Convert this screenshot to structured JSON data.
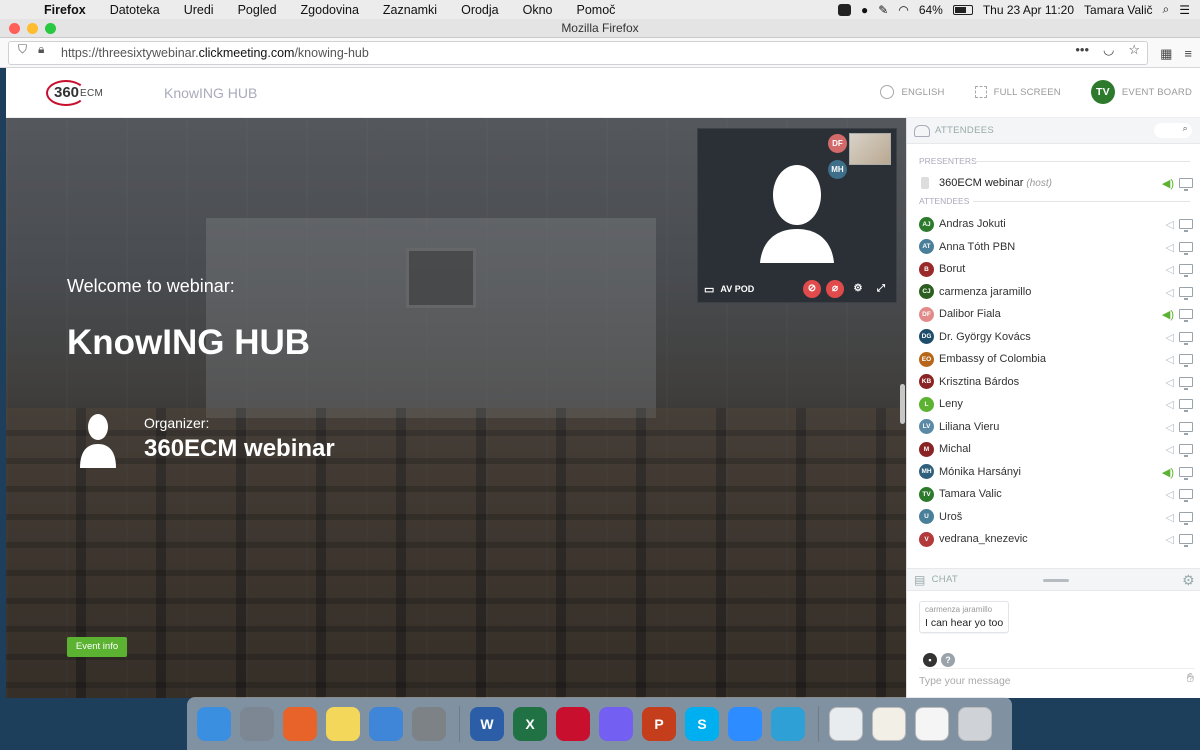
{
  "menubar": {
    "app": "Firefox",
    "items": [
      "Datoteka",
      "Uredi",
      "Pogled",
      "Zgodovina",
      "Zaznamki",
      "Orodja",
      "Okno",
      "Pomoč"
    ],
    "battery": "64%",
    "datetime": "Thu 23 Apr  11:20",
    "user": "Tamara Valič"
  },
  "browser": {
    "window_title": "Mozilla Firefox",
    "url_prefix": "https://threesixtywebinar.",
    "url_domain": "clickmeeting.com",
    "url_path": "/knowing-hub"
  },
  "header": {
    "logo_main": "360",
    "logo_sub": "ECM",
    "hub": "KnowING HUB",
    "language": "ENGLISH",
    "fullscreen": "FULL SCREEN",
    "user_initials": "TV",
    "event_board": "EVENT BOARD"
  },
  "stage": {
    "welcome": "Welcome to webinar:",
    "title": "KnowING HUB",
    "organizer_label": "Organizer:",
    "organizer_name": "360ECM webinar",
    "event_info": "Event info"
  },
  "video": {
    "label": "AV POD",
    "bubbles": [
      {
        "initials": "DF",
        "color": "#d36a6a"
      },
      {
        "initials": "MH",
        "color": "#3d6e8a"
      }
    ]
  },
  "attendees_panel": {
    "title": "ATTENDEES",
    "presenters_label": "PRESENTERS",
    "host_name": "360ECM webinar",
    "host_tag": "(host)",
    "attendees_label": "ATTENDEES",
    "list": [
      {
        "initials": "AJ",
        "name": "Andras Jokuti",
        "color": "#2d7a2d",
        "speaking": false
      },
      {
        "initials": "AT",
        "name": "Anna Tóth PBN",
        "color": "#4a7f9a",
        "speaking": false
      },
      {
        "initials": "B",
        "name": "Borut",
        "color": "#9a2a2a",
        "speaking": false
      },
      {
        "initials": "CJ",
        "name": "carmenza jaramillo",
        "color": "#2c5f1f",
        "speaking": false
      },
      {
        "initials": "DF",
        "name": "Dalibor Fiala",
        "color": "#e28a8a",
        "speaking": true
      },
      {
        "initials": "DG",
        "name": "Dr. György Kovács",
        "color": "#1f4e6a",
        "speaking": false
      },
      {
        "initials": "EO",
        "name": "Embassy of Colombia",
        "color": "#b6671a",
        "speaking": false
      },
      {
        "initials": "KB",
        "name": "Krisztina Bárdos",
        "color": "#8a2424",
        "speaking": false
      },
      {
        "initials": "L",
        "name": "Leny",
        "color": "#5bb331",
        "speaking": false
      },
      {
        "initials": "LV",
        "name": "Liliana Vieru",
        "color": "#5a8aa6",
        "speaking": false
      },
      {
        "initials": "M",
        "name": "Michal",
        "color": "#8a2424",
        "speaking": false
      },
      {
        "initials": "MH",
        "name": "Mónika Harsányi",
        "color": "#2f5f7a",
        "speaking": true
      },
      {
        "initials": "TV",
        "name": "Tamara Valic",
        "color": "#2d7a2d",
        "speaking": false
      },
      {
        "initials": "U",
        "name": "Uroš",
        "color": "#4a7f9a",
        "speaking": false
      },
      {
        "initials": "V",
        "name": "vedrana_knezevic",
        "color": "#b33a3a",
        "speaking": false
      }
    ]
  },
  "chat": {
    "title": "CHAT",
    "message_author": "carmenza jaramillo",
    "message_text": "I can hear yo too",
    "input_placeholder": "Type your message"
  },
  "dock": {
    "apps": [
      {
        "name": "finder",
        "color": "#3b8fe0",
        "glyph": ""
      },
      {
        "name": "launchpad",
        "color": "#7d8794",
        "glyph": ""
      },
      {
        "name": "firefox",
        "color": "#e8632a",
        "glyph": ""
      },
      {
        "name": "notes",
        "color": "#f3d75a",
        "glyph": ""
      },
      {
        "name": "keynote",
        "color": "#3f86d8",
        "glyph": ""
      },
      {
        "name": "system-preferences",
        "color": "#7d8287",
        "glyph": ""
      },
      {
        "name": "word",
        "color": "#2b5ea7",
        "glyph": "W"
      },
      {
        "name": "excel",
        "color": "#207245",
        "glyph": "X"
      },
      {
        "name": "acrobat",
        "color": "#c8102e",
        "glyph": ""
      },
      {
        "name": "viber",
        "color": "#7360f2",
        "glyph": ""
      },
      {
        "name": "powerpoint",
        "color": "#c43e1c",
        "glyph": "P"
      },
      {
        "name": "skype",
        "color": "#00aff0",
        "glyph": "S"
      },
      {
        "name": "zoom",
        "color": "#2d8cff",
        "glyph": ""
      },
      {
        "name": "edge",
        "color": "#2fa0d6",
        "glyph": ""
      }
    ]
  }
}
